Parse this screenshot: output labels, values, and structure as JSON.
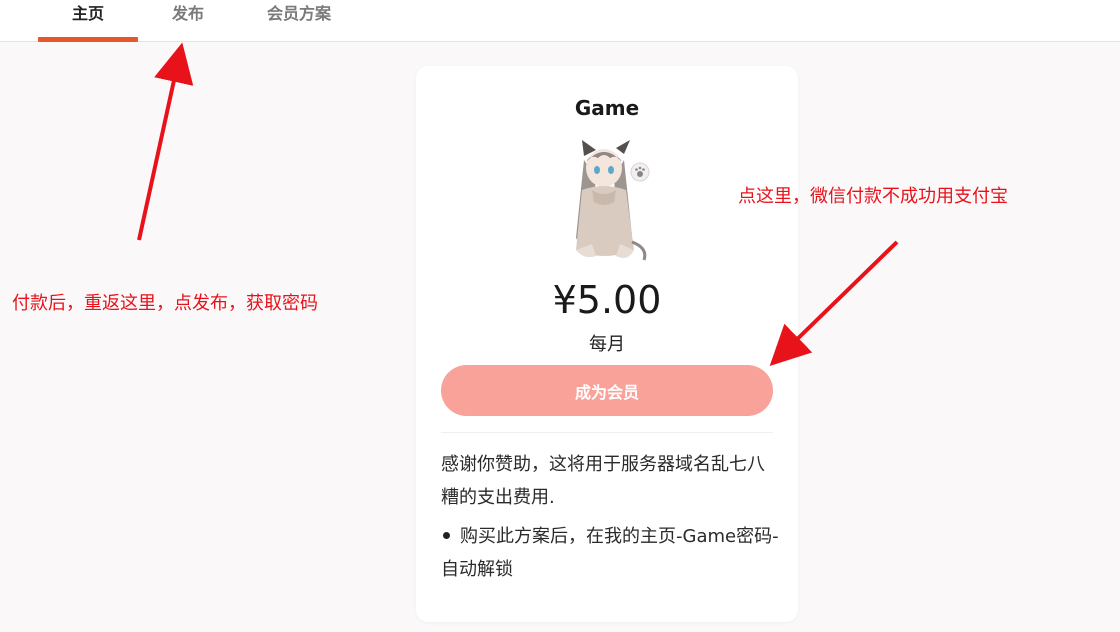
{
  "nav": {
    "tabs": [
      {
        "label": "主页",
        "active": true
      },
      {
        "label": "发布",
        "active": false
      },
      {
        "label": "会员方案",
        "active": false
      }
    ],
    "accent_color": "#e8572c"
  },
  "plan": {
    "title": "Game",
    "price": "¥5.00",
    "period": "每月",
    "join_button": "成为会员",
    "button_color": "#f8a29a",
    "description": "感谢你赞助，这将用于服务器域名乱七八糟的支出费用.",
    "bullet": "购买此方案后，在我的主页-Game密码-自动解锁"
  },
  "annotations": {
    "left_note": "付款后，重返这里，点发布，获取密码",
    "right_note": "点这里，微信付款不成功用支付宝",
    "color": "#e8121a"
  }
}
